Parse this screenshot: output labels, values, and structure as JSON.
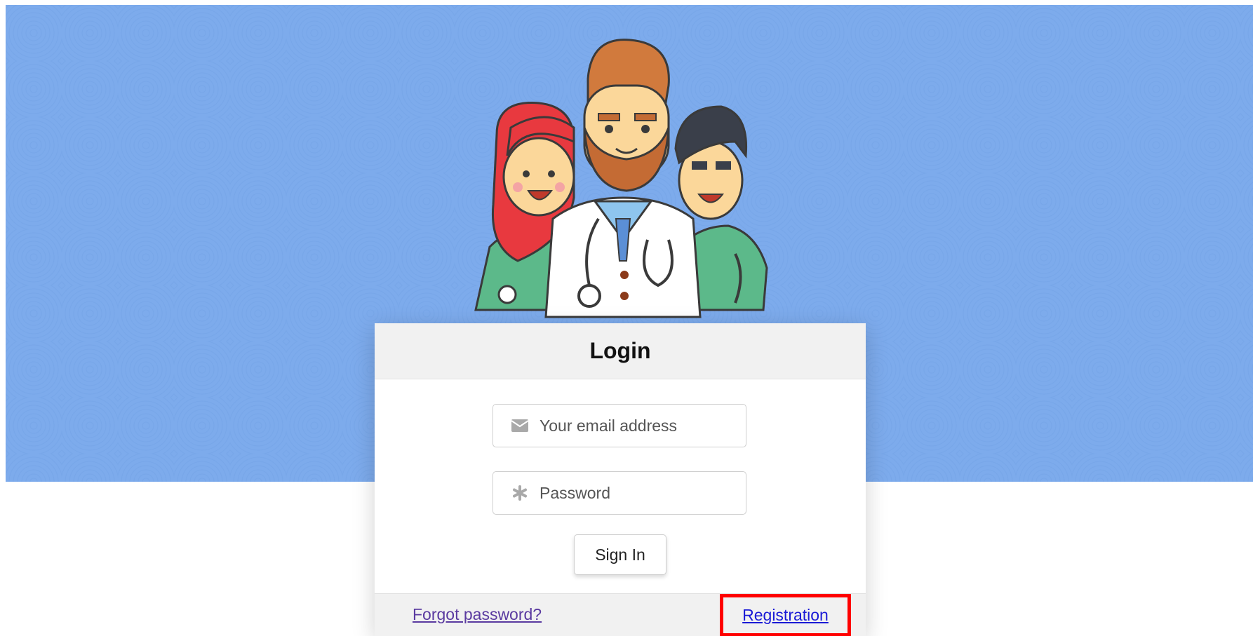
{
  "login": {
    "title": "Login",
    "email_placeholder": "Your email address",
    "password_placeholder": "Password",
    "signin_label": "Sign In",
    "forgot_label": "Forgot password?",
    "registration_label": "Registration"
  },
  "icons": {
    "email": "envelope-icon",
    "password": "asterisk-icon"
  },
  "colors": {
    "banner": "#7dabec",
    "highlight": "#ff0000",
    "link": "#1a1ad6",
    "visited_link": "#5a3aa0"
  }
}
